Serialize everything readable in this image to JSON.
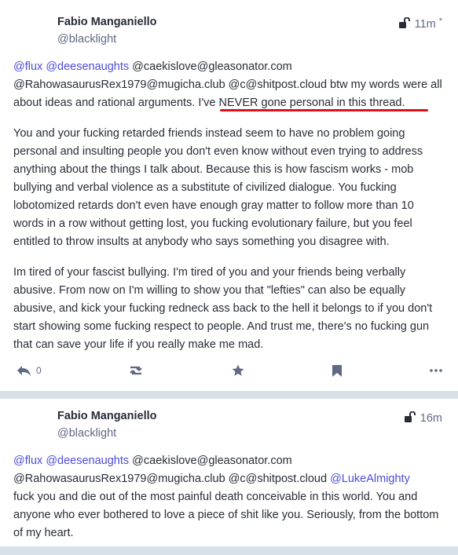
{
  "posts": [
    {
      "display_name": "Fabio Manganiello",
      "handle": "@blacklight",
      "time": "11m",
      "time_mark": "*",
      "visibility_icon": "unlock-icon",
      "mentions_line1": [
        "@flux",
        "@deesenaughts"
      ],
      "text_line1_rest": " @caekislove@gleasonator.com",
      "text_line2": "@RahowasaurusRex1979@mugicha.club @c@shitpost.cloud btw my words were all about ideas and rational arguments.",
      "highlight_text": " I've NEVER gone personal in this thread.",
      "paragraph2": "You and your fucking retarded friends instead seem to have no problem going personal and insulting people you don't even know without even trying to address anything about the things I talk about. Because this is how fascism works - mob bullying and verbal violence as a substitute of civilized dialogue. You fucking lobotomized retards don't even have enough gray matter to follow more than 10 words in a row without getting lost, you fucking evolutionary failure, but you feel entitled to throw insults at anybody who says something you disagree with.",
      "paragraph3": "Im tired of your fascist bullying. I'm tired of you and your friends being verbally abusive. From now on I'm willing to show you that \"lefties\" can also be equally abusive, and kick your fucking redneck ass back to the hell it belongs to if you don't start showing some fucking respect to people. And trust me, there's no fucking gun that can save your life if you really make me mad.",
      "reply_count": "0",
      "underline_color": "#e0101a"
    },
    {
      "display_name": "Fabio Manganiello",
      "handle": "@blacklight",
      "time": "16m",
      "visibility_icon": "unlock-icon",
      "mentions_line1": [
        "@flux",
        "@deesenaughts"
      ],
      "text_line1_rest": " @caekislove@gleasonator.com",
      "text_line2_plain": "@RahowasaurusRex1979@mugicha.club @c@shitpost.cloud ",
      "text_line2_mention": "@LukeAlmighty",
      "body": "fuck you and die out of the most painful death conceivable in this world. You and anyone who ever bothered to love a piece of shit like you. Seriously, from the bottom of my heart."
    }
  ],
  "colors": {
    "mention": "#4c4cda",
    "text": "#282c37",
    "muted": "#606984",
    "background": "#d9e1e8"
  },
  "action_icons": [
    "reply-icon",
    "boost-icon",
    "favourite-icon",
    "bookmark-icon",
    "more-icon"
  ]
}
